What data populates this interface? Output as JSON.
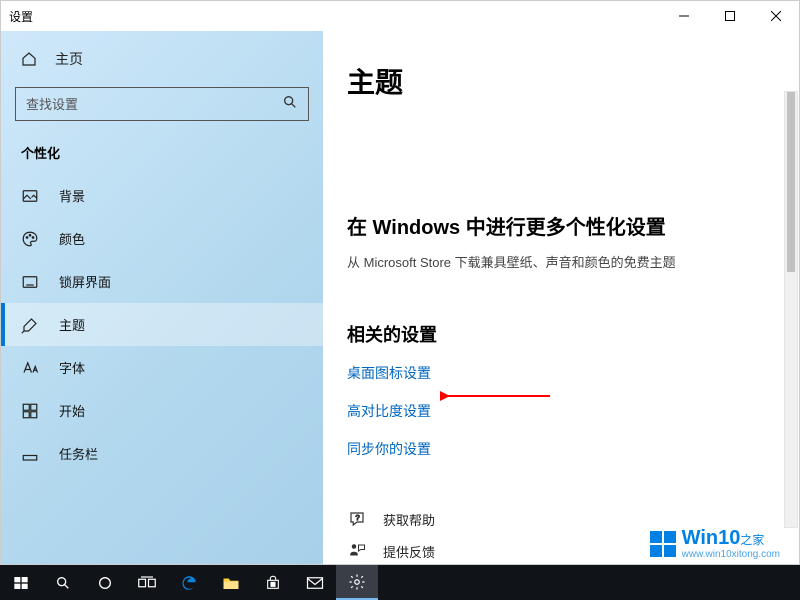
{
  "window": {
    "title": "设置"
  },
  "sidebar": {
    "home": "主页",
    "search_placeholder": "查找设置",
    "category": "个性化",
    "items": [
      {
        "label": "背景"
      },
      {
        "label": "颜色"
      },
      {
        "label": "锁屏界面"
      },
      {
        "label": "主题"
      },
      {
        "label": "字体"
      },
      {
        "label": "开始"
      },
      {
        "label": "任务栏"
      }
    ]
  },
  "content": {
    "title": "主题",
    "store_heading": "在 Windows 中进行更多个性化设置",
    "store_sub": "从 Microsoft Store 下载兼具壁纸、声音和颜色的免费主题",
    "related_heading": "相关的设置",
    "links": [
      "桌面图标设置",
      "高对比度设置",
      "同步你的设置"
    ],
    "help": [
      "获取帮助",
      "提供反馈"
    ]
  },
  "watermark": {
    "brand": "Win10",
    "suffix": "之家",
    "url": "www.win10xitong.com"
  }
}
